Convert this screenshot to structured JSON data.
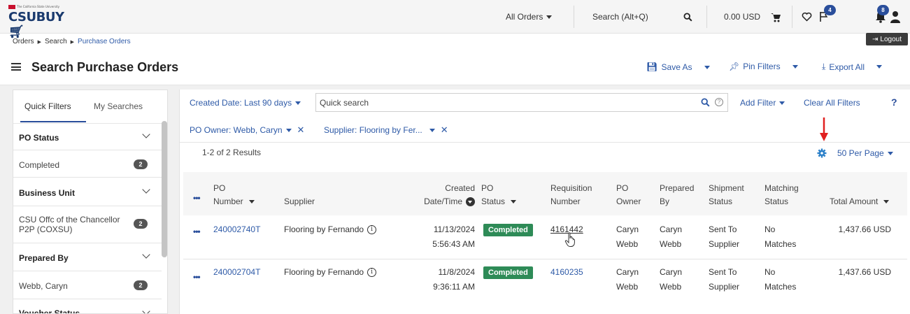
{
  "app": {
    "logo_word": "CSUBUY",
    "logo_tag": "The California State University"
  },
  "header": {
    "scope_dropdown": "All Orders",
    "search_label": "Search (Alt+Q)",
    "cart_amount": "0.00 USD",
    "flag_badge": "4",
    "bell_badge": "8",
    "logout_label": "Logout"
  },
  "breadcrumb": [
    "Orders",
    "Search",
    "Purchase Orders"
  ],
  "page": {
    "title": "Search Purchase Orders",
    "save_as": "Save As",
    "pin_filters": "Pin Filters",
    "export_all": "Export All"
  },
  "sidebar": {
    "tabs": [
      "Quick Filters",
      "My Searches"
    ],
    "sections": [
      {
        "title": "PO Status",
        "items": [
          {
            "label": "Completed",
            "count": "2"
          }
        ]
      },
      {
        "title": "Business Unit",
        "items": [
          {
            "label": "CSU Offc of the Chancellor P2P (COXSU)",
            "count": "2"
          }
        ]
      },
      {
        "title": "Prepared By",
        "items": [
          {
            "label": "Webb, Caryn",
            "count": "2"
          }
        ]
      },
      {
        "title": "Voucher Status",
        "items": []
      }
    ]
  },
  "filters": {
    "created_date": "Created Date: Last 90 days",
    "quick_search_placeholder": "Quick search",
    "add_filter": "Add Filter",
    "clear_all": "Clear All Filters",
    "help": "?",
    "po_owner": "PO Owner: Webb, Caryn",
    "supplier": "Supplier: Flooring by Fer..."
  },
  "results": {
    "summary": "1-2 of 2 Results",
    "per_page": "50 Per Page"
  },
  "table": {
    "columns": [
      {
        "line1": "PO",
        "line2": "Number"
      },
      {
        "line1": "",
        "line2": "Supplier"
      },
      {
        "line1": "Created",
        "line2": "Date/Time"
      },
      {
        "line1": "PO",
        "line2": "Status"
      },
      {
        "line1": "Requisition",
        "line2": "Number"
      },
      {
        "line1": "PO",
        "line2": "Owner"
      },
      {
        "line1": "Prepared",
        "line2": "By"
      },
      {
        "line1": "Shipment",
        "line2": "Status"
      },
      {
        "line1": "Matching",
        "line2": "Status"
      },
      {
        "line1": "",
        "line2": "Total Amount"
      }
    ],
    "rows": [
      {
        "po_number": "240002740T",
        "supplier": "Flooring by Fernando",
        "created_date": "11/13/2024",
        "created_time": "5:56:43 AM",
        "status": "Completed",
        "requisition": "4161442",
        "owner_first": "Caryn",
        "owner_last": "Webb",
        "prepared_first": "Caryn",
        "prepared_last": "Webb",
        "shipment_1": "Sent To",
        "shipment_2": "Supplier",
        "matching_1": "No",
        "matching_2": "Matches",
        "total": "1,437.66 USD"
      },
      {
        "po_number": "240002704T",
        "supplier": "Flooring by Fernando",
        "created_date": "11/8/2024",
        "created_time": "9:36:11 AM",
        "status": "Completed",
        "requisition": "4160235",
        "owner_first": "Caryn",
        "owner_last": "Webb",
        "prepared_first": "Caryn",
        "prepared_last": "Webb",
        "shipment_1": "Sent To",
        "shipment_2": "Supplier",
        "matching_1": "No",
        "matching_2": "Matches",
        "total": "1,437.66 USD"
      }
    ]
  },
  "colors": {
    "brand_navy": "#1a3a6e",
    "link_blue": "#2e5aa7",
    "status_green": "#2e8b57",
    "annotation_red": "#e02020"
  }
}
